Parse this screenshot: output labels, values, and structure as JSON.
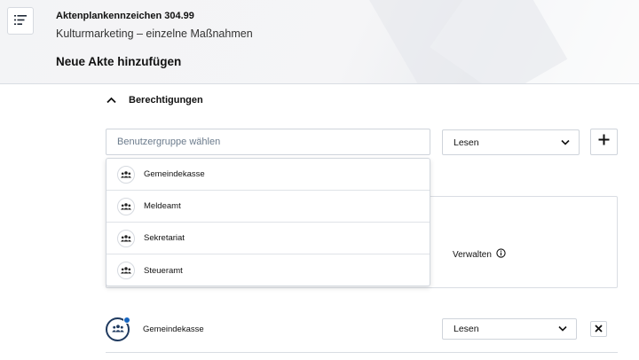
{
  "header": {
    "code": "Aktenplankennzeichen 304.99",
    "subtitle": "Kulturmarketing – einzelne Maßnahmen",
    "page_title": "Neue Akte hinzufügen"
  },
  "permissions": {
    "section_label": "Berechtigungen",
    "group_input": {
      "placeholder": "Benutzergruppe wählen",
      "value": ""
    },
    "role_select_value": "Lesen",
    "dropdown_items": [
      {
        "label": "Gemeindekasse",
        "icon": "group-icon"
      },
      {
        "label": "Meldeamt",
        "icon": "group-icon"
      },
      {
        "label": "Sekretariat",
        "icon": "group-icon"
      },
      {
        "label": "Steueramt",
        "icon": "group-icon"
      }
    ],
    "panel_option_label": "Verwalten",
    "members": [
      {
        "name": "Gemeindekasse",
        "role": "Lesen"
      }
    ]
  },
  "colors": {
    "accent": "#1565c0",
    "avatar_border": "#1f3a5f"
  }
}
